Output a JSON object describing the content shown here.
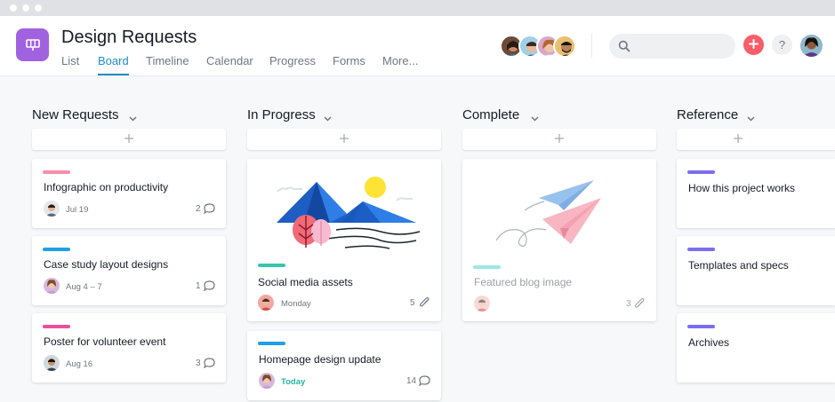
{
  "project": {
    "title": "Design Requests",
    "icon": "board-icon",
    "accent": "#a162e0"
  },
  "tabs": [
    {
      "label": "List"
    },
    {
      "label": "Board"
    },
    {
      "label": "Timeline"
    },
    {
      "label": "Calendar"
    },
    {
      "label": "Progress"
    },
    {
      "label": "Forms"
    },
    {
      "label": "More..."
    }
  ],
  "active_tab": "Board",
  "search": {
    "placeholder": ""
  },
  "header_actions": {
    "add_icon": "plus-icon",
    "help_label": "?"
  },
  "columns": [
    {
      "title": "New Requests",
      "cards": [
        {
          "title": "Infographic on productivity",
          "tag_color": "#f88fa9",
          "date": "Jul 19",
          "count": "2",
          "count_icon": "comment-icon"
        },
        {
          "title": "Case study layout designs",
          "tag_color": "#1e9fe8",
          "date": "Aug 4 – 7",
          "count": "1",
          "count_icon": "comment-icon"
        },
        {
          "title": "Poster for volunteer event",
          "tag_color": "#ea4e9d",
          "date": "Aug 16",
          "count": "3",
          "count_icon": "comment-icon"
        }
      ]
    },
    {
      "title": "In Progress",
      "cards": [
        {
          "title": "Social media assets",
          "tag_color": "#37c5ab",
          "date": "Monday",
          "count": "5",
          "count_icon": "attachment-icon",
          "image": "mountain-illustration"
        },
        {
          "title": "Homepage design update",
          "tag_color": "#1e9fe8",
          "date": "Today",
          "count": "14",
          "count_icon": "comment-icon"
        }
      ]
    },
    {
      "title": "Complete",
      "cards": [
        {
          "title": "Featured blog image",
          "tag_color": "#9ee7e3",
          "date": "",
          "count": "3",
          "count_icon": "attachment-icon",
          "image": "paper-plane-illustration"
        }
      ]
    },
    {
      "title": "Reference",
      "cards": [
        {
          "title": "How this project works",
          "tag_color": "#7a6ff0"
        },
        {
          "title": "Templates and specs",
          "tag_color": "#7a6ff0"
        },
        {
          "title": "Archives",
          "tag_color": "#7a6ff0"
        }
      ]
    }
  ]
}
